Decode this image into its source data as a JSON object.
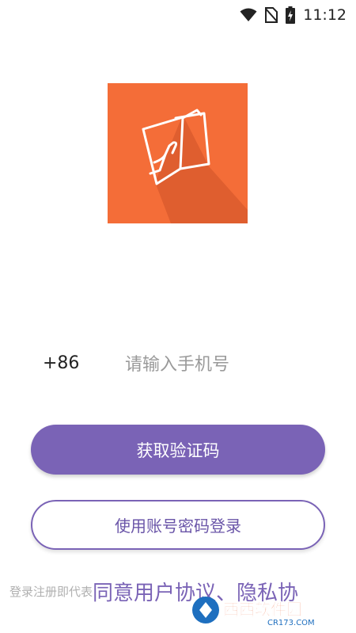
{
  "status_bar": {
    "time": "11:12",
    "icons": [
      "wifi-icon",
      "no-sim-icon",
      "battery-charging-icon"
    ]
  },
  "logo": {
    "icon": "app-logo-icon",
    "color": "#F46D38"
  },
  "phone": {
    "country_code": "+86",
    "placeholder": "请输入手机号",
    "value": ""
  },
  "buttons": {
    "get_code": "获取验证码",
    "password_login": "使用账号密码登录"
  },
  "agreement": {
    "prefix": "登录注册即代表",
    "link": "同意用户协议、隐私协"
  },
  "watermark": {
    "text": "西西软件园",
    "url": "CR173.COM"
  },
  "colors": {
    "primary": "#7A63B6",
    "logo_bg": "#F46D38",
    "placeholder": "#9A9A9A"
  }
}
